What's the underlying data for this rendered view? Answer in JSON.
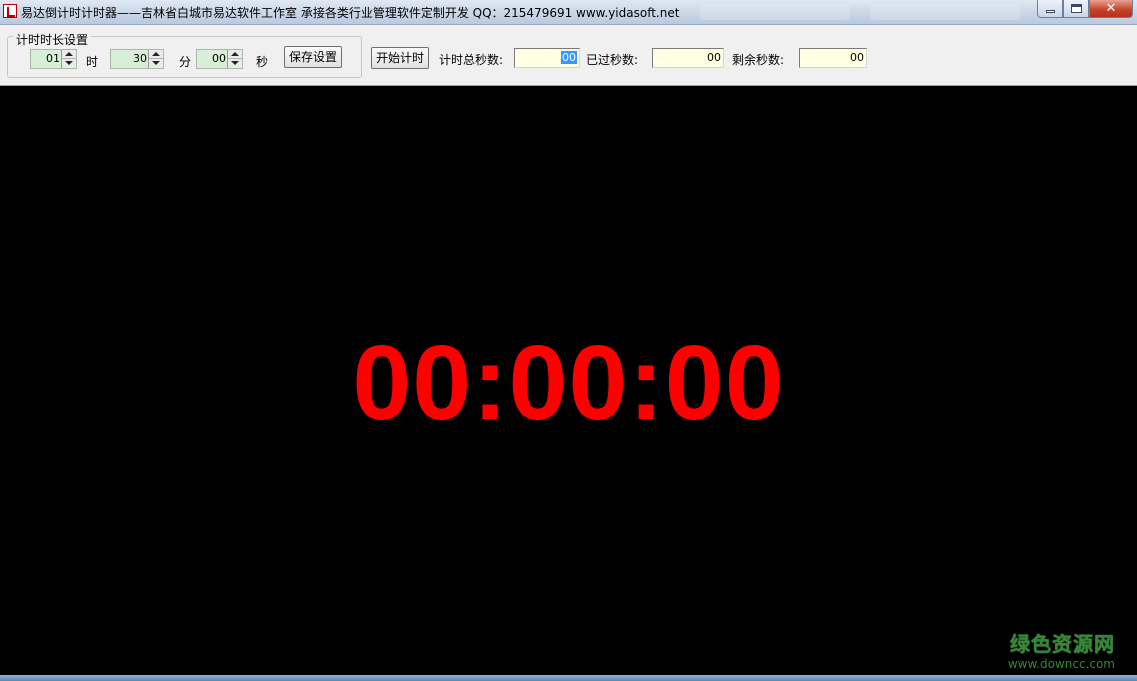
{
  "window": {
    "title": "易达倒计时计时器——吉林省白城市易达软件工作室   承接各类行业管理软件定制开发  QQ：215479691  www.yidasoft.net",
    "background_tabs": [
      "...",
      "..."
    ]
  },
  "settings": {
    "group_label": "计时时长设置",
    "hours_value": "01",
    "hours_unit": "时",
    "minutes_value": "30",
    "minutes_unit": "分",
    "seconds_value": "00",
    "seconds_unit": "秒",
    "save_label": "保存设置"
  },
  "controls": {
    "start_label": "开始计时",
    "total_seconds_label": "计时总秒数:",
    "total_seconds_value": "00",
    "elapsed_seconds_label": "已过秒数:",
    "elapsed_seconds_value": "00",
    "remaining_seconds_label": "剩余秒数:",
    "remaining_seconds_value": "00"
  },
  "display": {
    "time": "00:00:00",
    "time_color": "#ff0000",
    "background_color": "#000000"
  },
  "watermark": {
    "main": "绿色资源网",
    "sub": "www.downcc.com"
  }
}
